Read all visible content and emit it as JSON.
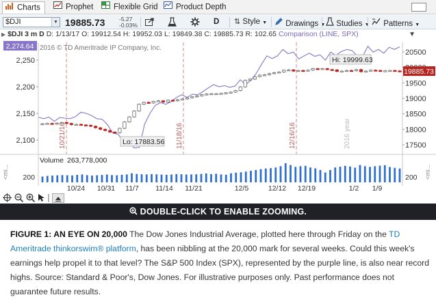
{
  "tabs": [
    {
      "label": "Charts",
      "icon": "bar-chart-icon",
      "active": true
    },
    {
      "label": "Prophet",
      "icon": "prophet-icon",
      "active": false
    },
    {
      "label": "Flexible Grid",
      "icon": "grid-icon",
      "active": false
    },
    {
      "label": "Product Depth",
      "icon": "product-depth-icon",
      "active": false
    }
  ],
  "toolbar": {
    "symbol": "$DJI",
    "last_price": "19885.73",
    "change_points": "-5.27",
    "change_percent": "-0.03%",
    "aggregation": "D",
    "style_label": "Style",
    "drawings_label": "Drawings",
    "studies_label": "Studies",
    "patterns_label": "Patterns"
  },
  "chart_header": {
    "symbol_period": "$DJI 3 m D",
    "date": "D: 1/13/17",
    "open": "O: 19912.54",
    "high": "H: 19952.03",
    "low": "L: 19849.38",
    "close": "C: 19885.73",
    "range": "R: 102.65",
    "comparison": "Comparison (LINE, SPX)"
  },
  "chart_data": {
    "type": "candlestick",
    "copyright": "2016 © TD Ameritrade IP Company, Inc.",
    "left_axis_ticks": [
      2100,
      2150,
      2200,
      2250
    ],
    "left_axis_ticklabels": [
      "2,100",
      "2,150",
      "2,200",
      "2,250"
    ],
    "right_axis_ticks": [
      17500,
      18000,
      18500,
      19000,
      19500,
      20000,
      20500
    ],
    "right_axis_ticklabels": [
      "17500",
      "18000",
      "18500",
      "19000",
      "19500",
      "20000",
      "20500"
    ],
    "spx_current_label": "2,274.64",
    "dji_current_label": "19885.73",
    "annotations": {
      "high": "Hi: 19999.63",
      "low": "Lo: 17883.56",
      "year": "2016 year"
    },
    "vertical_markers": [
      "10/21/16",
      "11/18/16",
      "12/16/16"
    ],
    "dji_close": [
      18180,
      18190,
      18170,
      18200,
      18220,
      18190,
      18150,
      18160,
      18140,
      18130,
      18100,
      18050,
      18000,
      17960,
      17910,
      17890,
      18030,
      18240,
      18400,
      18590,
      18810,
      18870,
      18850,
      18900,
      18920,
      18880,
      18940,
      18920,
      18960,
      18980,
      19020,
      19050,
      19080,
      19120,
      19140,
      19150,
      19150,
      19160,
      19180,
      19200,
      19250,
      19370,
      19580,
      19620,
      19700,
      19750,
      19760,
      19800,
      19830,
      19850,
      19910,
      19920,
      19880,
      19900,
      19890,
      19910,
      19960,
      19940,
      19960,
      19930,
      19920,
      19870,
      19880,
      19900,
      19890,
      19930,
      19860,
      19880,
      19910,
      19900,
      19890,
      19890,
      19900,
      19886,
      19880
    ],
    "spx_close": [
      2143,
      2140,
      2143,
      2135,
      2142,
      2141,
      2140,
      2144,
      2152,
      2150,
      2146,
      2140,
      2139,
      2129,
      2113,
      2111,
      2097,
      2096,
      2085,
      2086,
      2130,
      2150,
      2165,
      2170,
      2167,
      2172,
      2180,
      2185,
      2180,
      2186,
      2185,
      2191,
      2198,
      2204,
      2200,
      2202,
      2199,
      2201,
      2213,
      2204,
      2212,
      2225,
      2242,
      2258,
      2253,
      2258,
      2270,
      2262,
      2265,
      2252,
      2258,
      2263,
      2257,
      2260,
      2250,
      2265,
      2259,
      2266,
      2270,
      2268,
      2258,
      2256,
      2276,
      2265,
      2270,
      2263,
      2274,
      2270,
      2275
    ],
    "volume_label": "Volume",
    "volume_value": "263,778,000",
    "volume_axis_tick": "200",
    "volume": [
      70,
      78,
      82,
      85,
      88,
      86,
      84,
      90,
      96,
      88,
      82,
      86,
      90,
      95,
      88,
      86,
      92,
      96,
      110,
      102,
      98,
      96,
      100,
      97,
      94,
      92,
      95,
      100,
      98,
      95,
      96,
      98,
      102,
      108,
      100,
      104,
      96,
      92,
      110,
      118,
      122,
      130,
      140,
      150,
      160,
      168,
      172,
      180,
      196,
      232,
      210,
      188,
      196,
      200,
      180,
      170,
      150,
      120,
      150,
      180,
      190,
      200,
      192,
      178,
      210,
      196,
      188,
      196,
      202,
      208,
      186,
      176,
      168
    ],
    "x_tick_labels": [
      "10/24",
      "10/31",
      "11/7",
      "11/14",
      "11/21",
      "12/5",
      "12/12",
      "12/19",
      "1/2",
      "1/9"
    ],
    "colors": {
      "up": "#666666",
      "down": "#b8231d",
      "spx_line": "#8874c9",
      "vertical_marker": "#d98a8a",
      "volume": "#2f6fd0"
    }
  },
  "bottom_tools": [
    "crosshair-icon",
    "zoom-out-icon",
    "zoom-in-icon",
    "pointer-icon",
    "drag-icon",
    "pan-icon"
  ],
  "zoom_banner": "DOUBLE-CLICK TO ENABLE ZOOMING.",
  "caption": {
    "figure_label": "FIGURE 1: AN EYE ON 20,000",
    "text_before_link": " The Dow Jones Industrial Average, plotted here through Friday on the ",
    "link_text": "TD Ameritrade thinkorswim® platform",
    "text_after_link": ", has been nibbling at the 20,000 mark for several weeks. Could this week's earnings help propel it to that level? The S&P 500 Index (SPX), represented by the purple line, is also near record highs. Source: Standard & Poor's, Dow Jones. For illustrative purposes only. Past performance does not guarantee future results."
  }
}
